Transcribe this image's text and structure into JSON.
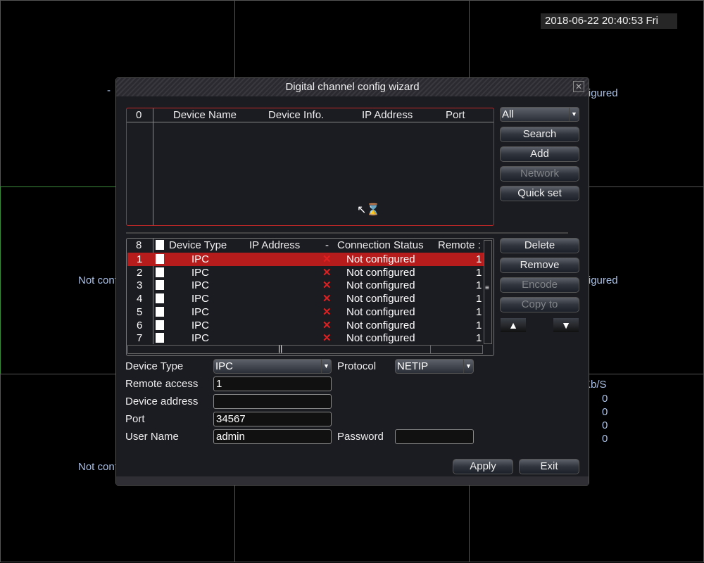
{
  "clock": "2018-06-22 20:40:53 Fri",
  "background": {
    "channel_status": "Not configured",
    "dash": "-",
    "bitrate_header": "Kb/S",
    "bitrate_values": [
      "0",
      "0",
      "0",
      "0"
    ]
  },
  "dialog": {
    "title": "Digital channel config wizard",
    "close_icon": "close-icon",
    "search_list": {
      "count": "0",
      "columns": [
        "Device Name",
        "Device Info.",
        "IP Address",
        "Port"
      ],
      "rows": []
    },
    "filter": {
      "selected": "All"
    },
    "buttons": {
      "search": "Search",
      "add": "Add",
      "network": "Network",
      "quick_set": "Quick set",
      "delete": "Delete",
      "remove": "Remove",
      "encode": "Encode",
      "copy_to": "Copy to",
      "apply": "Apply",
      "exit": "Exit"
    },
    "channel_list": {
      "count": "8",
      "columns": [
        "Device Type",
        "IP Address",
        "-",
        "Connection Status",
        "Remote :"
      ],
      "rows": [
        {
          "n": "1",
          "type": "IPC",
          "ip": "",
          "status": "Not configured",
          "remote": "1",
          "selected": true
        },
        {
          "n": "2",
          "type": "IPC",
          "ip": "",
          "status": "Not configured",
          "remote": "1"
        },
        {
          "n": "3",
          "type": "IPC",
          "ip": "",
          "status": "Not configured",
          "remote": "1"
        },
        {
          "n": "4",
          "type": "IPC",
          "ip": "",
          "status": "Not configured",
          "remote": "1"
        },
        {
          "n": "5",
          "type": "IPC",
          "ip": "",
          "status": "Not configured",
          "remote": "1"
        },
        {
          "n": "6",
          "type": "IPC",
          "ip": "",
          "status": "Not configured",
          "remote": "1"
        },
        {
          "n": "7",
          "type": "IPC",
          "ip": "",
          "status": "Not configured",
          "remote": "1"
        }
      ]
    },
    "form": {
      "device_type_label": "Device Type",
      "device_type": "IPC",
      "protocol_label": "Protocol",
      "protocol": "NETIP",
      "remote_access_label": "Remote access",
      "remote_access": "1",
      "device_address_label": "Device address",
      "device_address": "",
      "port_label": "Port",
      "port": "34567",
      "user_name_label": "User Name",
      "user_name": "admin",
      "password_label": "Password",
      "password": ""
    }
  },
  "colors": {
    "selected_row": "#b71c1c",
    "list_border": "#c02828",
    "status_x": "#e02020",
    "bg_text": "#a9c0e6"
  }
}
